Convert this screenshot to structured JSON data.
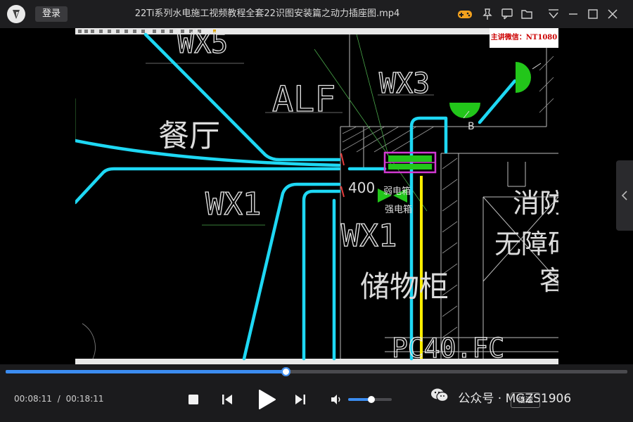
{
  "window": {
    "title": "22Ti系列水电施工视频教程全套22识图安装篇之动力插座图.mp4",
    "login_label": "登录"
  },
  "video_overlay": {
    "watermark_text": "主讲微信：NT1080"
  },
  "cad_drawing": {
    "labels": {
      "wx5": "WX5",
      "wx3": "WX3",
      "alf": "ALF",
      "wx1_left": "WX1",
      "wx1_center": "WX1",
      "dining": "餐厅",
      "storage": "储物柜",
      "dim_400": "400",
      "fire_1": "消防",
      "fire_2": "无障碍",
      "fire_3": "客",
      "pc": "PC40.FC",
      "weak_1": "弱电箱",
      "weak_2": "强电箱",
      "b": "B"
    }
  },
  "player": {
    "progress": 0.45,
    "current_time": "00:08:11",
    "separator": "/",
    "total_time": "00:18:11",
    "volume": 0.53,
    "speed_label": "倍速",
    "wechat_label": "公众号 · MGZS1906",
    "wechat_id": ""
  },
  "colors": {
    "accent": "#3b8cf0",
    "cad_cyan": "#1ed8f4",
    "cad_green": "#22c61a",
    "cad_magenta": "#d33ad3",
    "cad_yellow": "#ffee00"
  },
  "icons": [
    "app-logo-icon",
    "gamepad-icon",
    "pin-icon",
    "feedback-icon",
    "folder-icon",
    "menu-icon",
    "minimize-icon",
    "maximize-icon",
    "close-icon",
    "stop-icon",
    "prev-icon",
    "play-icon",
    "next-icon",
    "volume-icon",
    "chevron-left-icon",
    "wechat-icon"
  ]
}
